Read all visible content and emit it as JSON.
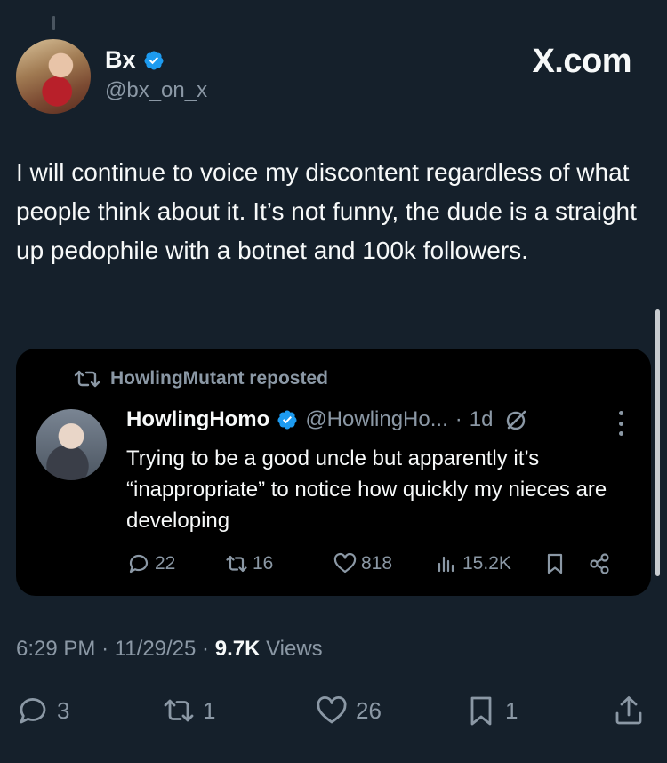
{
  "author": {
    "name": "Bx",
    "handle": "@bx_on_x"
  },
  "brand": "X.com",
  "tweet_text": "I will continue to voice my discontent regardless of what people think about it. It’s not funny, the dude is a straight up pedophile with a botnet and 100k followers.",
  "quoted": {
    "repost_label": "HowlingMutant reposted",
    "name": "HowlingHomo",
    "handle": "@HowlingHo...",
    "time": "1d",
    "text": "Trying to be a good uncle but apparently it’s “inappropriate” to notice how quickly my nieces are developing",
    "replies": "22",
    "reposts": "16",
    "likes": "818",
    "views": "15.2K"
  },
  "meta": {
    "time": "6:29 PM",
    "date": "11/29/25",
    "views_count": "9.7K",
    "views_label": "Views"
  },
  "actions": {
    "replies": "3",
    "reposts": "1",
    "likes": "26",
    "bookmarks": "1"
  },
  "colors": {
    "background": "#15202b",
    "quote_background": "#000000",
    "muted_text": "#8b98a5",
    "verified": "#1d9bf0"
  }
}
